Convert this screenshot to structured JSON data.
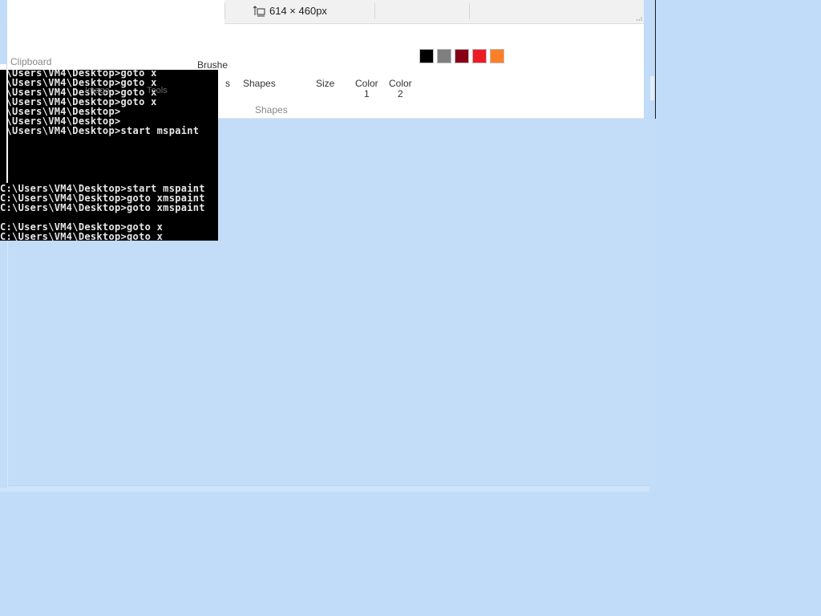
{
  "status_bar": {
    "canvas_size": "614 × 460px",
    "canvas_size_icon": "canvas-size-icon"
  },
  "ribbon": {
    "clipboard_label": "Clipboard",
    "brushes_label": "Brushe",
    "shapes_cut_label": "s",
    "shapes_label": "Shapes",
    "size_label": "Size",
    "color1_label_a": "Color",
    "color1_label_b": "1",
    "color2_label_a": "Color",
    "color2_label_b": "2",
    "shapes_group_label": "Shapes",
    "tools_ghost": "Tools",
    "image_ghost": "Image"
  },
  "colors": {
    "swatches": [
      "#000000",
      "#7f7f7f",
      "#880015",
      "#ed1c24",
      "#ff7f27"
    ],
    "canvas_bg": "#c3dcf8",
    "desktop_bg": "#c0dcf9"
  },
  "console": {
    "lines": [
      ":\\Users\\VM4\\Desktop>goto x",
      ":\\Users\\VM4\\Desktop>goto x",
      ":\\Users\\VM4\\Desktop>goto x",
      ":\\Users\\VM4\\Desktop>goto x",
      ":\\Users\\VM4\\Desktop>",
      ":\\Users\\VM4\\Desktop>",
      ":\\Users\\VM4\\Desktop>start mspaint",
      "C:\\Users\\VM4\\Desktop>start mspaint",
      "C:\\Users\\VM4\\Desktop>goto xmspaint",
      "C:\\Users\\VM4\\Desktop>goto xmspaint",
      "C:\\Users\\VM4\\Desktop>goto x",
      "C:\\Users\\VM4\\Desktop>goto x"
    ]
  }
}
